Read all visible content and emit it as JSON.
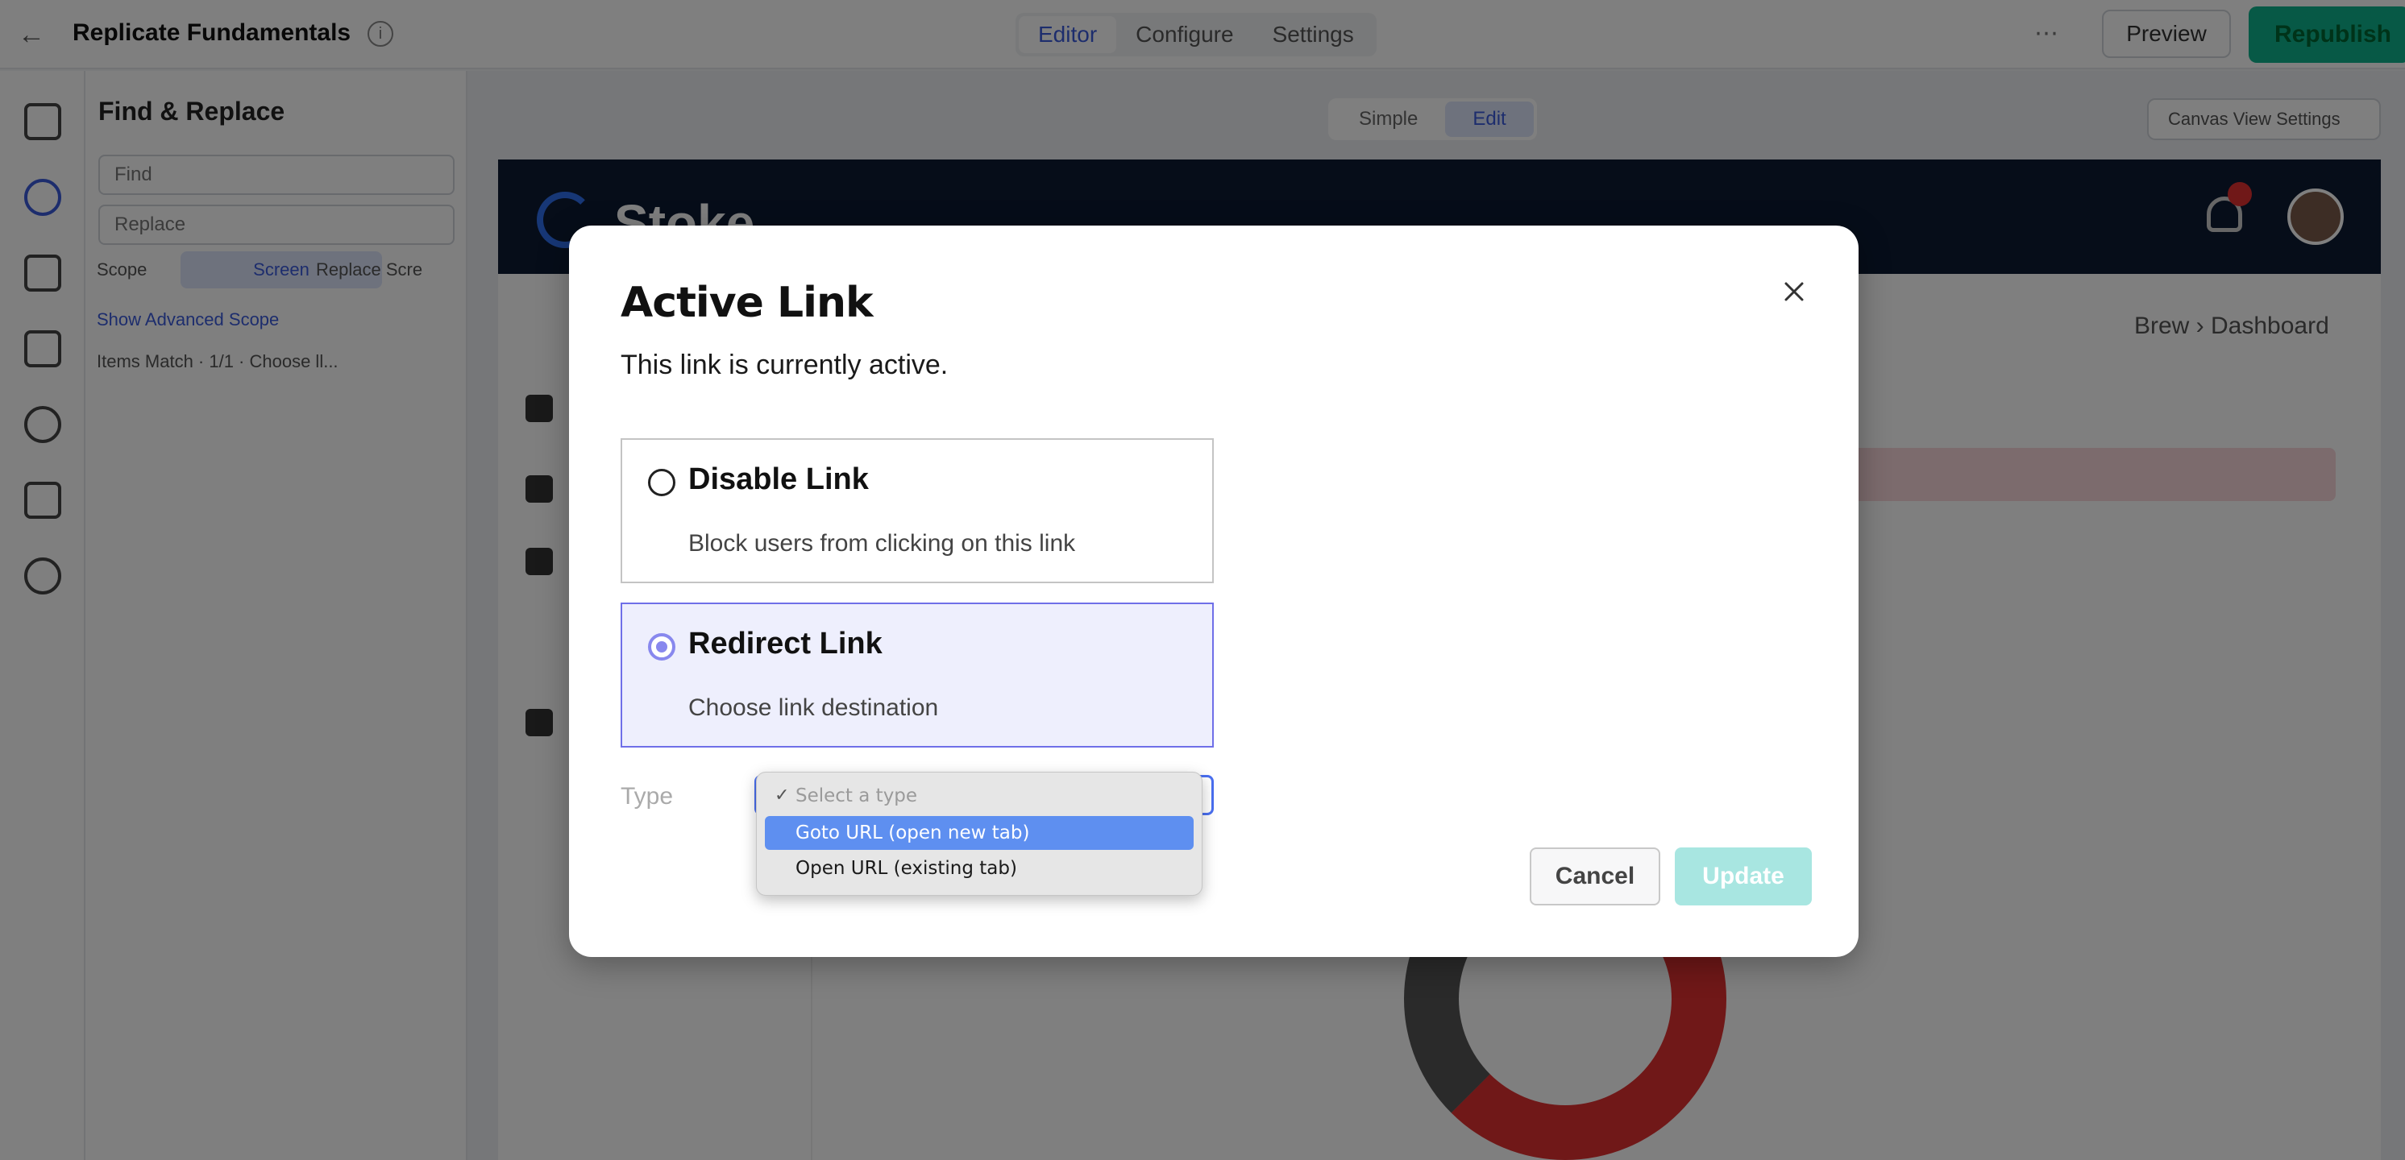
{
  "app": {
    "title": "Replicate Fundamentals",
    "tabs": [
      "Editor",
      "Configure",
      "Settings"
    ],
    "preview_label": "Preview",
    "republish_label": "Republish"
  },
  "left_panel": {
    "title": "Find & Replace",
    "find_placeholder": "Find",
    "replace_placeholder": "Replace",
    "scope_label": "Scope",
    "scope_value": "Screen",
    "scope_extra": "Replace Scre",
    "link_text": "Show Advanced Scope",
    "row_text": "Items Match · 1/1 · Choose ll..."
  },
  "canvas": {
    "view_toggle": [
      "Simple",
      "Edit"
    ],
    "view_settings_label": "Canvas View Settings",
    "brand": "Stoke",
    "breadcrumbs": "Brew  ›  Dashboard"
  },
  "modal": {
    "title": "Active Link",
    "subtitle": "This link is currently active.",
    "options": [
      {
        "label": "Disable Link",
        "description": "Block users from clicking on this link",
        "selected": false
      },
      {
        "label": "Redirect Link",
        "description": "Choose link destination",
        "selected": true
      }
    ],
    "type_label": "Type",
    "cancel_label": "Cancel",
    "update_label": "Update"
  },
  "dropdown": {
    "placeholder": "Select a type",
    "items": [
      "Goto URL (open new tab)",
      "Open URL (existing tab)"
    ],
    "highlighted_index": 0
  },
  "colors": {
    "accent": "#6f6fe8",
    "selected_bg": "#eeeffd",
    "update_disabled": "#a8e6e1",
    "dropdown_highlight": "#5e8ff0",
    "republish": "#0fb38d"
  }
}
